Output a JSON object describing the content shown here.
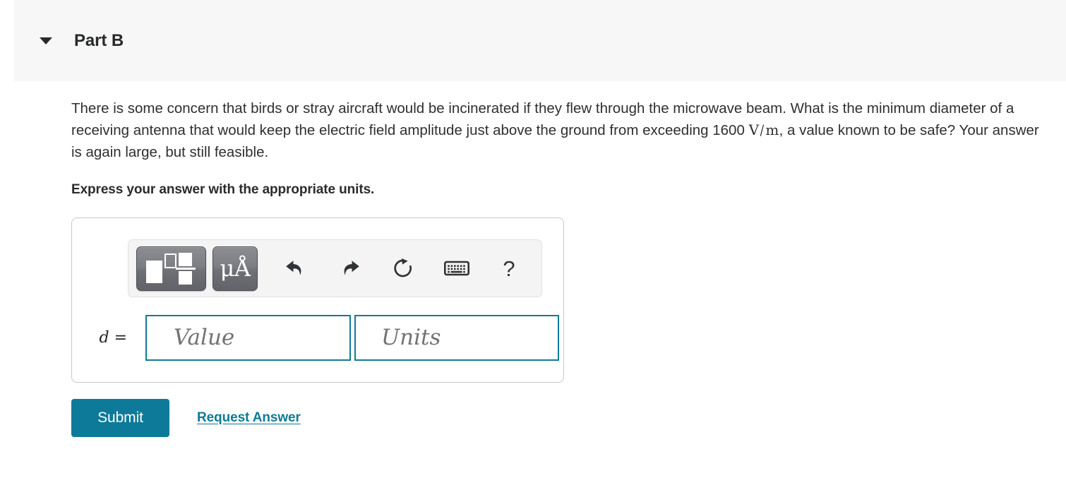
{
  "header": {
    "toggle_icon": "caret-down-icon",
    "title": "Part B"
  },
  "question": {
    "text_before_unit": "There is some concern that birds or stray aircraft would be incinerated if they flew through the microwave beam. What is the minimum diameter of a receiving antenna that would keep the electric field amplitude just above the ground from exceeding 1600 ",
    "unit_numerator": "V",
    "unit_slash": "/",
    "unit_denominator": "m",
    "text_after_unit": ", a value known to be safe? Your answer is again large, but still feasible.",
    "instruction": "Express your answer with the appropriate units."
  },
  "toolbar": {
    "template_button": {
      "icon": "math-template-icon",
      "label": ""
    },
    "units_button": {
      "icon": "micro-angstrom-units-icon",
      "label": "μÅ"
    },
    "undo": {
      "icon": "undo-arrow-icon"
    },
    "redo": {
      "icon": "redo-arrow-icon"
    },
    "reset": {
      "icon": "reset-circular-arrow-icon"
    },
    "keyboard": {
      "icon": "keyboard-icon"
    },
    "help": {
      "icon": "question-mark-icon",
      "label": "?"
    }
  },
  "answer": {
    "variable_label": "d",
    "equals": "=",
    "value_placeholder": "Value",
    "units_placeholder": "Units",
    "value_current": "",
    "units_current": ""
  },
  "actions": {
    "submit_label": "Submit",
    "request_answer_label": "Request Answer"
  },
  "colors": {
    "accent_teal": "#0e7a99",
    "field_border": "#117a96",
    "header_bg": "#f7f7f7",
    "text": "#2f2f2f"
  }
}
